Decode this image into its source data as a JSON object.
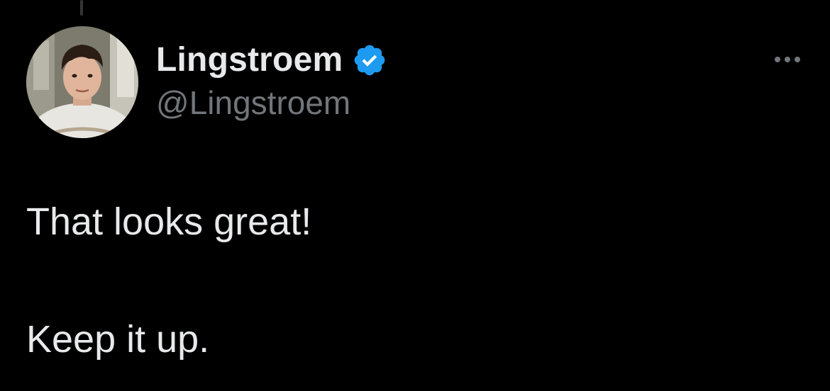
{
  "colors": {
    "background": "#000000",
    "text": "#e7e9ea",
    "secondary_text": "#71767b",
    "verified_badge": "#1d9bf0",
    "thread_line": "#333639"
  },
  "icons": {
    "verified": "verified-badge-icon",
    "more": "more-horizontal-icon"
  },
  "tweet": {
    "author": {
      "display_name": "Lingstroem",
      "handle": "@Lingstroem",
      "verified": true
    },
    "text_lines": [
      "That looks great!",
      "Keep it up."
    ]
  }
}
